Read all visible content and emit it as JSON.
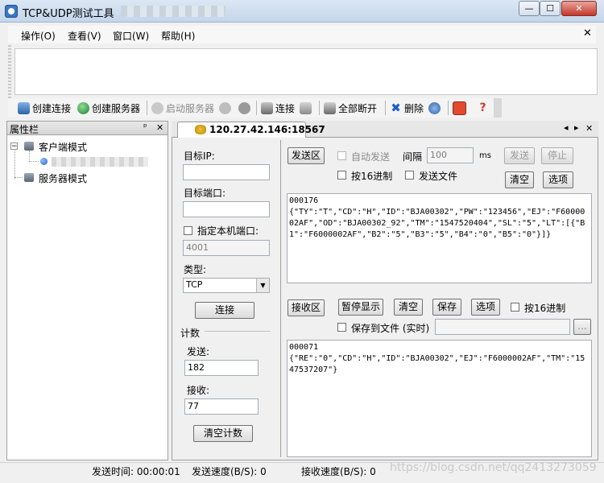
{
  "window": {
    "title": "TCP&UDP测试工具",
    "minimize_glyph": "—",
    "maximize_glyph": "☐",
    "close_glyph": "✕"
  },
  "menu": {
    "items": [
      "操作(O)",
      "查看(V)",
      "窗口(W)",
      "帮助(H)"
    ],
    "close_glyph": "✕"
  },
  "toolbar": {
    "create_connection": "创建连接",
    "create_server": "创建服务器",
    "start_server": "启动服务器",
    "connect": "连接",
    "disconnect_all": "全部断开",
    "delete": "删除"
  },
  "property_panel": {
    "title": "属性栏",
    "pin_glyph": "ᵖ",
    "close_glyph": "✕",
    "tree": {
      "client_mode": "客户端模式",
      "server_mode": "服务器模式",
      "collapse_glyph": "−"
    }
  },
  "connection_tab": {
    "label": "120.27.42.146:18567",
    "nav_prev": "◂",
    "nav_next": "▸",
    "close_glyph": "✕"
  },
  "left_form": {
    "target_ip_label": "目标IP:",
    "target_ip_value": "",
    "target_port_label": "目标端口:",
    "target_port_value": "",
    "local_port_label": "指定本机端口:",
    "local_port_value": "4001",
    "type_label": "类型:",
    "type_value": "TCP",
    "connect_button": "连接",
    "count_label": "计数",
    "send_label": "发送:",
    "send_count": "182",
    "recv_label": "接收:",
    "recv_count": "77",
    "clear_count_button": "清空计数"
  },
  "send_area": {
    "send_area_button": "发送区",
    "auto_send_label": "自动发送",
    "interval_label": "间隔",
    "interval_value": "100",
    "interval_unit": "ms",
    "send_button": "发送",
    "stop_button": "停止",
    "hex_label": "按16进制",
    "send_file_label": "发送文件",
    "clear_button": "清空",
    "options_button": "选项",
    "content": "000176\n{\"TY\":\"T\",\"CD\":\"H\",\"ID\":\"BJA00302\",\"PW\":\"123456\",\"EJ\":\"F6000002AF\",\"OD\":\"BJA00302_92\",\"TM\":\"1547520404\",\"SL\":\"5\",\"LT\":[{\"B1\":\"F6000002AF\",\"B2\":\"5\",\"B3\":\"5\",\"B4\":\"0\",\"B5\":\"0\"}]}"
  },
  "recv_area": {
    "recv_area_button": "接收区",
    "pause_button": "暂停显示",
    "clear_button": "清空",
    "save_button": "保存",
    "options_button": "选项",
    "hex_label": "按16进制",
    "save_to_file_label": "保存到文件 (实时)",
    "browse_button": "...",
    "content": "000071\n{\"RE\":\"0\",\"CD\":\"H\",\"ID\":\"BJA00302\",\"EJ\":\"F6000002AF\",\"TM\":\"1547537207\"}"
  },
  "status": {
    "send_time": "发送时间: 00:00:01",
    "send_speed": "发送速度(B/S): 0",
    "recv_speed": "接收速度(B/S): 0",
    "watermark": "https://blog.csdn.net/qq2413273059"
  },
  "colors": {
    "accent_blue": "#3a78c2",
    "disabled_text": "#8a8a8a",
    "title_gradient_top": "#dbe7f4"
  },
  "icons": {
    "create_connection": "connection-icon",
    "create_server": "globe-server-icon",
    "start_server": "gear-people-icon",
    "stop": "stop-icon",
    "disconnect_all": "unplug-icon",
    "delete": "delete-x-icon",
    "settings": "gear-icon",
    "about": "red-square-icon",
    "help": "red-question-icon"
  }
}
